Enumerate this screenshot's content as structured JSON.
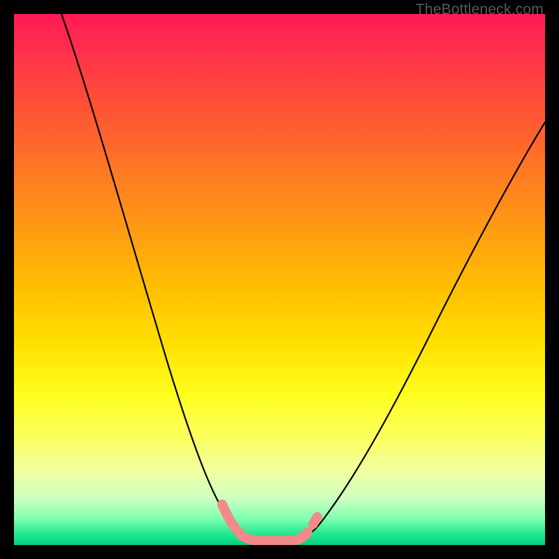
{
  "watermark": "TheBottleneck.com",
  "chart_data": {
    "type": "line",
    "title": "",
    "xlabel": "",
    "ylabel": "",
    "xlim": [
      0,
      100
    ],
    "ylim": [
      0,
      100
    ],
    "grid": false,
    "series": [
      {
        "name": "bottleneck-curve",
        "x": [
          10,
          15,
          20,
          25,
          30,
          35,
          38,
          40,
          42,
          44,
          46,
          48,
          50,
          52,
          55,
          60,
          65,
          70,
          75,
          80,
          85,
          90,
          95,
          100
        ],
        "values": [
          100,
          88,
          75,
          62,
          48,
          34,
          24,
          16,
          9,
          4,
          1,
          0,
          0,
          0,
          1,
          4,
          9,
          16,
          25,
          34,
          44,
          54,
          64,
          72
        ]
      }
    ],
    "annotations": [
      {
        "name": "highlight-segment",
        "type": "thick-stroke",
        "color": "#f28a8a",
        "x": [
          38,
          40,
          42,
          44,
          46,
          48,
          50,
          52,
          54,
          55
        ],
        "values": [
          24,
          16,
          9,
          4,
          1,
          0,
          0,
          0,
          1,
          2
        ]
      }
    ],
    "colors": {
      "curve": "#000000",
      "highlight": "#f28a8a",
      "gradient_top": "#ff1a55",
      "gradient_bottom": "#00d080",
      "frame": "#000000"
    }
  }
}
